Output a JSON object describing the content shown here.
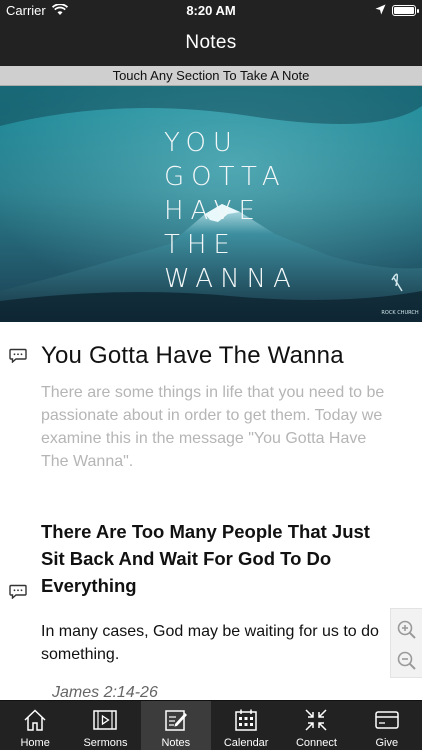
{
  "status": {
    "carrier": "Carrier",
    "time": "8:20 AM"
  },
  "nav": {
    "title": "Notes"
  },
  "hint": "Touch Any Section To Take A Note",
  "hero": {
    "lines": [
      "YOU",
      "GOTTA",
      "HAVE",
      "THE",
      "WANNA"
    ],
    "logo_text": "ROCK CHURCH"
  },
  "section": {
    "title": "You Gotta Have The Wanna",
    "description": "There are some things in life that you need to be passionate about in order to get them. Today we examine this in the message \"You Gotta Have The Wanna\"."
  },
  "point": {
    "title": "There Are Too Many People That Just Sit Back And Wait For God To Do Everything",
    "body": "In many cases, God may be waiting for us to do something.",
    "scripture": "James 2:14-26"
  },
  "tabs": [
    {
      "label": "Home",
      "icon": "home-icon"
    },
    {
      "label": "Sermons",
      "icon": "film-icon"
    },
    {
      "label": "Notes",
      "icon": "notes-icon"
    },
    {
      "label": "Calendar",
      "icon": "calendar-icon"
    },
    {
      "label": "Connect",
      "icon": "connect-icon"
    },
    {
      "label": "Give",
      "icon": "wallet-icon"
    }
  ],
  "colors": {
    "bars": "#222222",
    "active_tab": "#3c3c3c",
    "hint_bg": "#cfcfcf",
    "desc_text": "#b5b5b5"
  }
}
